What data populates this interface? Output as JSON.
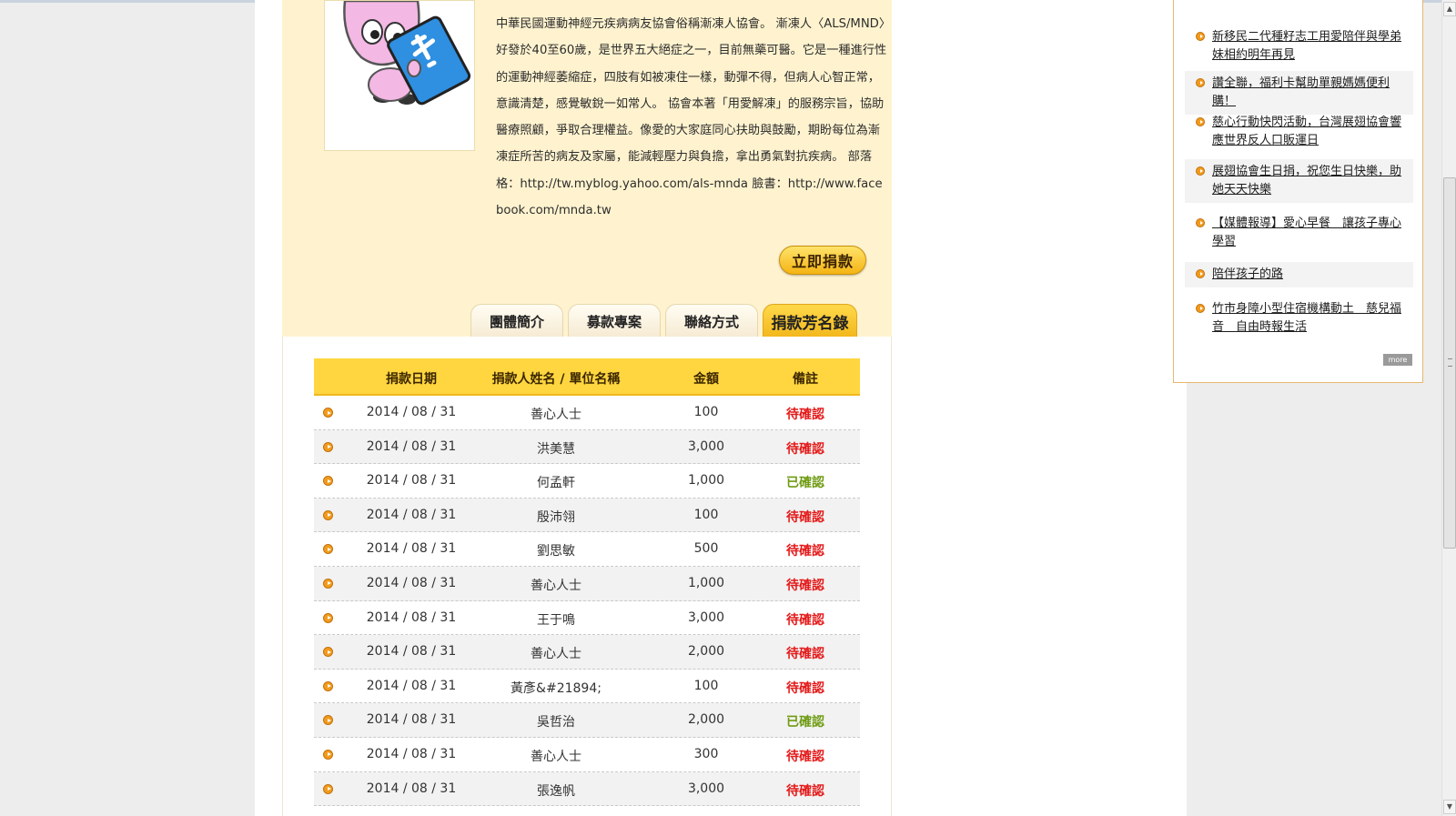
{
  "organization": {
    "description": "中華民國運動神經元疾病病友協會俗稱漸凍人協會。 漸凍人〈ALS/MND〉好發於40至60歲，是世界五大絕症之一，目前無藥可醫。它是一種進行性的運動神經萎縮症，四肢有如被凍住一樣，動彈不得，但病人心智正常，意識清楚，感覺敏銳一如常人。 協會本著「用愛解凍」的服務宗旨，協助醫療照顧，爭取合理權益。像愛的大家庭同心扶助與鼓勵，期盼每位為漸凍症所苦的病友及家屬，能減輕壓力與負擔，拿出勇氣對抗疾病。 部落格：http://tw.myblog.yahoo.com/als-mnda 臉書：http://www.facebook.com/mnda.tw",
    "donate_label": "立即捐款"
  },
  "tabs": [
    {
      "label": "團體簡介",
      "active": false
    },
    {
      "label": "募款專案",
      "active": false
    },
    {
      "label": "聯絡方式",
      "active": false
    },
    {
      "label": "捐款芳名錄",
      "active": true
    }
  ],
  "donations": {
    "columns": [
      "捐款日期",
      "捐款人姓名 / 單位名稱",
      "金額",
      "備註"
    ],
    "rows": [
      {
        "date": "2014 / 08 / 31",
        "name": "善心人士",
        "amount": "100",
        "status": "待確認"
      },
      {
        "date": "2014 / 08 / 31",
        "name": "洪美慧",
        "amount": "3,000",
        "status": "待確認"
      },
      {
        "date": "2014 / 08 / 31",
        "name": "何孟軒",
        "amount": "1,000",
        "status": "已確認"
      },
      {
        "date": "2014 / 08 / 31",
        "name": "殷沛翎",
        "amount": "100",
        "status": "待確認"
      },
      {
        "date": "2014 / 08 / 31",
        "name": "劉思敏",
        "amount": "500",
        "status": "待確認"
      },
      {
        "date": "2014 / 08 / 31",
        "name": "善心人士",
        "amount": "1,000",
        "status": "待確認"
      },
      {
        "date": "2014 / 08 / 31",
        "name": "王于鳴",
        "amount": "3,000",
        "status": "待確認"
      },
      {
        "date": "2014 / 08 / 31",
        "name": "善心人士",
        "amount": "2,000",
        "status": "待確認"
      },
      {
        "date": "2014 / 08 / 31",
        "name": "黃彥&#21894;",
        "amount": "100",
        "status": "待確認"
      },
      {
        "date": "2014 / 08 / 31",
        "name": "吳哲治",
        "amount": "2,000",
        "status": "已確認"
      },
      {
        "date": "2014 / 08 / 31",
        "name": "善心人士",
        "amount": "300",
        "status": "待確認"
      },
      {
        "date": "2014 / 08 / 31",
        "name": "張逸帆",
        "amount": "3,000",
        "status": "待確認"
      }
    ]
  },
  "news": {
    "items": [
      "新移民二代種籽志工用愛陪伴與學弟妹相約明年再見",
      "讚全聯，福利卡幫助單親媽媽便利購！",
      "慈心行動快閃活動，台灣展翅協會響應世界反人口販運日",
      "展翅協會生日捐，祝您生日快樂，助她天天快樂",
      "【媒體報導】愛心早餐　讓孩子專心學習",
      "陪伴孩子的路",
      "竹市身障小型住宿機構動土　慈兒福音　自由時報生活"
    ],
    "more_label": "more"
  },
  "colors": {
    "panel_bg": "#fff3cf",
    "header_yellow": "#ffd63f",
    "pending_red": "#e41919",
    "confirmed_green": "#6f9b12"
  }
}
